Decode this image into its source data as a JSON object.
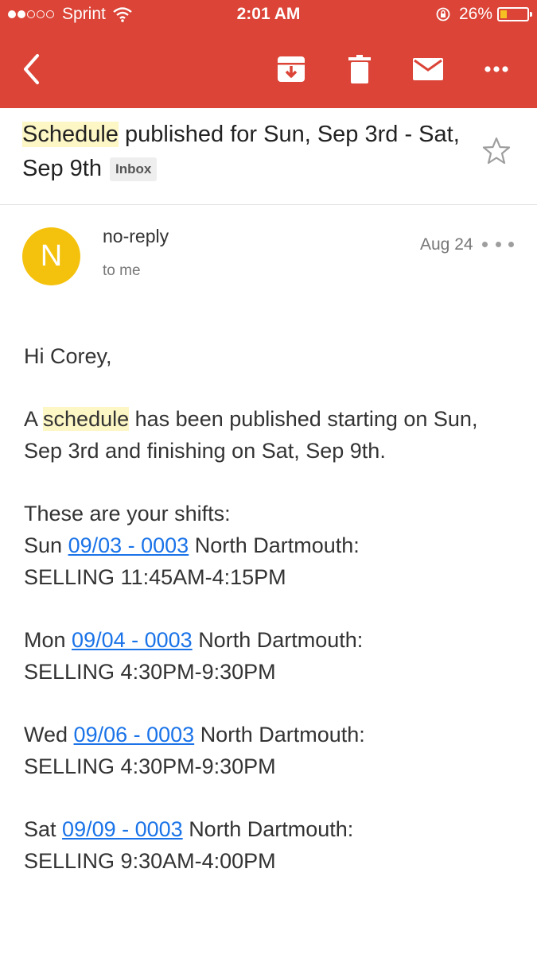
{
  "status_bar": {
    "carrier": "Sprint",
    "time": "2:01 AM",
    "battery_percent": "26%",
    "signal_bars_filled": 2,
    "signal_bars_total": 5,
    "battery_level": 0.26
  },
  "toolbar": {
    "icons": [
      "back-arrow-icon",
      "archive-icon",
      "trash-icon",
      "mail-icon",
      "more-horizontal-icon"
    ]
  },
  "subject": {
    "highlight": "Schedule",
    "rest": " published for Sun, Sep 3rd - Sat, Sep 9th",
    "label": "Inbox"
  },
  "message": {
    "avatar_letter": "N",
    "sender": "no-reply",
    "recipient": "to me",
    "date": "Aug 24",
    "greeting": "Hi Corey,",
    "intro_before": "A ",
    "intro_highlight": "schedule",
    "intro_after": " has been published starting on Sun, Sep 3rd and finishing on Sat, Sep 9th.",
    "shifts_heading": "These are your shifts:",
    "shifts": [
      {
        "day": "Sun",
        "link": "09/03 - 0003",
        "location": "North Dartmouth:",
        "detail": "SELLING 11:45AM-4:15PM"
      },
      {
        "day": "Mon",
        "link": "09/04 - 0003",
        "location": "North Dartmouth:",
        "detail": "SELLING 4:30PM-9:30PM"
      },
      {
        "day": "Wed",
        "link": "09/06 - 0003",
        "location": "North Dartmouth:",
        "detail": "SELLING 4:30PM-9:30PM"
      },
      {
        "day": "Sat",
        "link": "09/09 - 0003",
        "location": "North Dartmouth:",
        "detail": "SELLING 9:30AM-4:00PM"
      }
    ]
  },
  "colors": {
    "toolbar": "#db4437",
    "avatar": "#f4c20d",
    "highlight": "#fdf6c5",
    "link": "#1a73e8"
  }
}
